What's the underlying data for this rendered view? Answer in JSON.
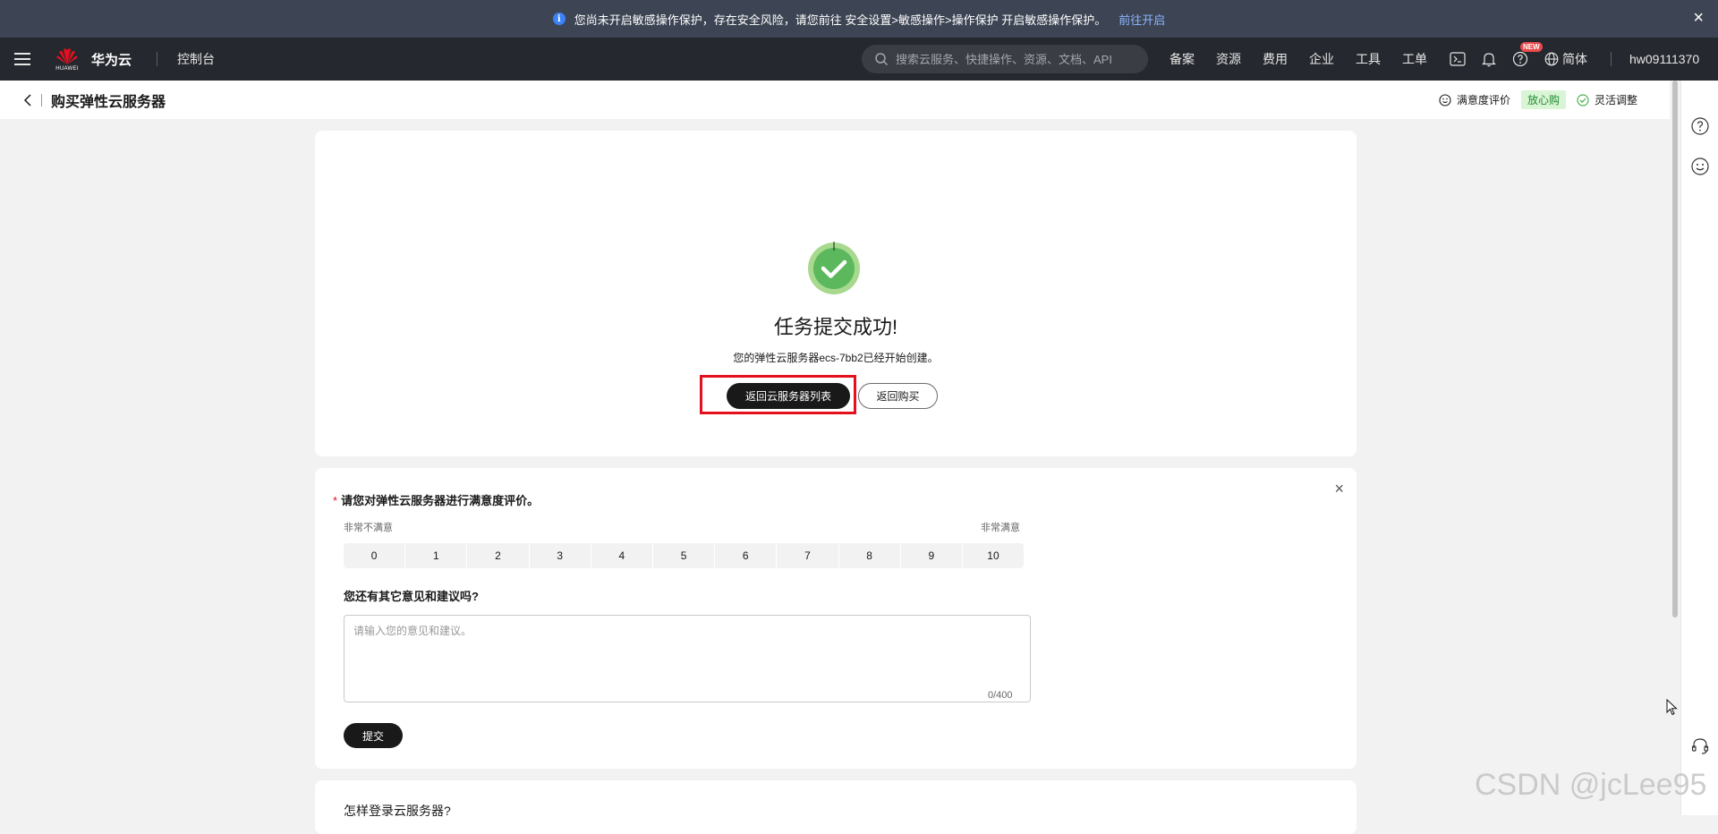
{
  "notice": {
    "text": "您尚未开启敏感操作保护，存在安全风险，请您前往 安全设置>敏感操作>操作保护 开启敏感操作保护。",
    "link": "前往开启",
    "close_icon": "×"
  },
  "topnav": {
    "logo_text": "HUAWEI",
    "brand": "华为云",
    "console": "控制台",
    "search_placeholder": "搜索云服务、快捷操作、资源、文档、API",
    "menu": [
      "备案",
      "资源",
      "费用",
      "企业",
      "工具",
      "工单"
    ],
    "new_badge": "NEW",
    "language": "简体",
    "user": "hw09111370"
  },
  "page_header": {
    "title": "购买弹性云服务器",
    "satisfaction": "满意度评价",
    "badge": "放心购",
    "flexible": "灵活调整"
  },
  "success": {
    "title": "任务提交成功!",
    "description": "您的弹性云服务器ecs-7bb2已经开始创建。",
    "primary_button": "返回云服务器列表",
    "secondary_button": "返回购买"
  },
  "survey": {
    "question": "请您对弹性云服务器进行满意度评价。",
    "required_mark": "*",
    "scale_low_label": "非常不满意",
    "scale_high_label": "非常满意",
    "scale": [
      "0",
      "1",
      "2",
      "3",
      "4",
      "5",
      "6",
      "7",
      "8",
      "9",
      "10"
    ],
    "feedback_question": "您还有其它意见和建议吗?",
    "feedback_placeholder": "请输入您的意见和建议。",
    "counter": "0/400",
    "submit": "提交",
    "close_icon": "×"
  },
  "help_card": {
    "title": "怎样登录云服务器?"
  },
  "watermark": "CSDN @jcLee95",
  "colors": {
    "notice_bg": "#3d4554",
    "nav_bg": "#25282e",
    "success_green": "#5cb85c",
    "highlight_red": "#e4101e",
    "button_dark": "#191919"
  }
}
